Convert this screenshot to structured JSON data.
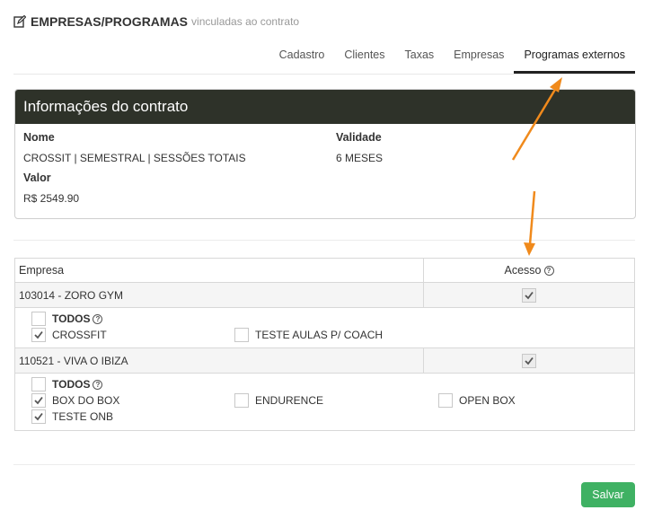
{
  "header": {
    "title": "EMPRESAS/PROGRAMAS",
    "subtitle": "vinculadas ao contrato"
  },
  "tabs": [
    {
      "label": "Cadastro",
      "active": false
    },
    {
      "label": "Clientes",
      "active": false
    },
    {
      "label": "Taxas",
      "active": false
    },
    {
      "label": "Empresas",
      "active": false
    },
    {
      "label": "Programas externos",
      "active": true
    }
  ],
  "contract_panel": {
    "title": "Informações do contrato",
    "name_label": "Nome",
    "name_value": "CROSSIT | SEMESTRAL | SESSÕES TOTAIS",
    "validity_label": "Validade",
    "validity_value": "6 MESES",
    "value_label": "Valor",
    "value_value": "R$ 2549.90"
  },
  "table": {
    "col_company": "Empresa",
    "col_access": "Acesso",
    "companies": [
      {
        "name": "103014 - ZORO GYM",
        "access": true,
        "all_label": "TODOS",
        "all_checked": false,
        "programs": [
          {
            "label": "CROSSFIT",
            "checked": true
          },
          {
            "label": "TESTE AULAS P/ COACH",
            "checked": false
          }
        ]
      },
      {
        "name": "110521 - VIVA O IBIZA",
        "access": true,
        "all_label": "TODOS",
        "all_checked": false,
        "programs": [
          {
            "label": "BOX DO BOX",
            "checked": true
          },
          {
            "label": "ENDURENCE",
            "checked": false
          },
          {
            "label": "OPEN BOX",
            "checked": false
          },
          {
            "label": "TESTE ONB",
            "checked": true
          }
        ]
      }
    ]
  },
  "actions": {
    "save_label": "Salvar"
  },
  "colors": {
    "panel_header": "#2e3229",
    "save_button": "#3fb163",
    "annotation_arrow": "#f08a1c"
  }
}
